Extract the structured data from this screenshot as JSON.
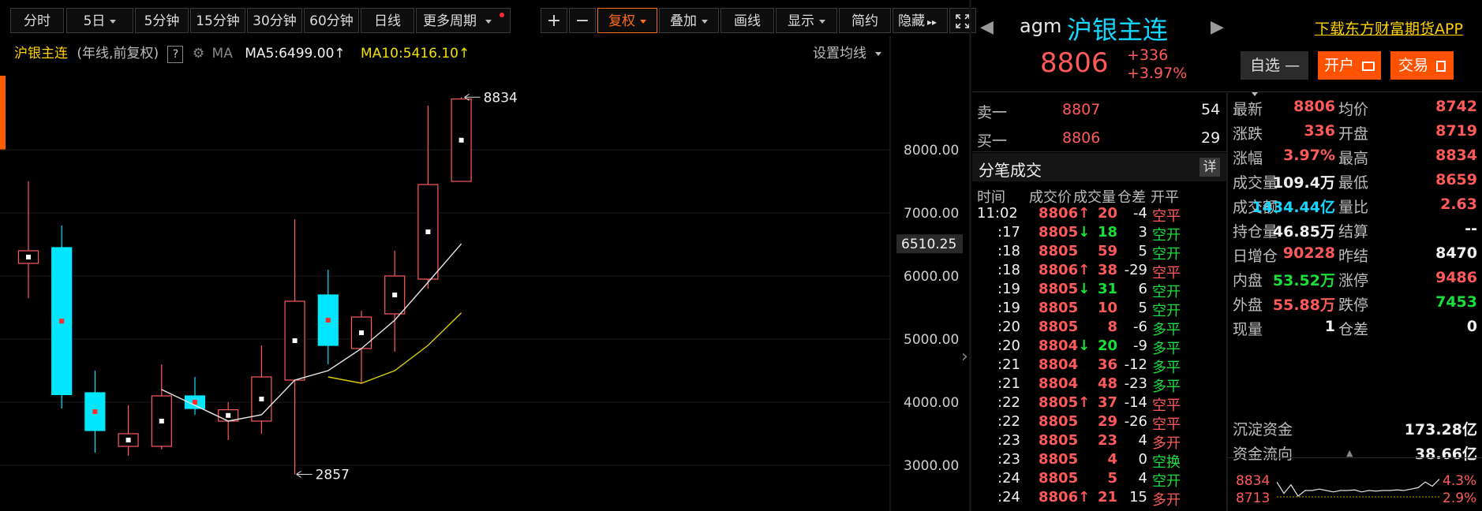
{
  "colors": {
    "up": "#ff5a5a",
    "down": "#00e6ff",
    "ma5": "#e6e6e6",
    "ma10": "#e0d800",
    "accent": "#ff6a1a",
    "buy_green": "#18e03a",
    "cyan": "#16d7ff"
  },
  "toolbar": {
    "tabs": [
      "分时",
      "5日",
      "5分钟",
      "15分钟",
      "30分钟",
      "60分钟",
      "日线",
      "更多周期"
    ],
    "plus": "+",
    "minus": "−",
    "fuquan": "复权",
    "overlay": "叠加",
    "draw": "画线",
    "display": "显示",
    "simple": "简约",
    "hide": "隐藏"
  },
  "legend": {
    "name": "沪银主连",
    "mode": "(年线,前复权)",
    "help": "?",
    "ma": "MA",
    "ma5": "MA5:6499.00",
    "ma10": "MA10:5416.10",
    "settings": "设置均线"
  },
  "chart_data": {
    "type": "candlestick",
    "ylim": [
      2700,
      9300
    ],
    "yticks": [
      3000,
      4000,
      5000,
      6000,
      7000,
      8000
    ],
    "price_tag": "6510.25",
    "price_tag_value": 6510.25,
    "high_annotation": "8834",
    "low_annotation": "2857",
    "candles": [
      {
        "o": 6200,
        "c": 6400,
        "h": 7500,
        "l": 5650
      },
      {
        "o": 6450,
        "c": 4120,
        "h": 6800,
        "l": 3900
      },
      {
        "o": 4150,
        "c": 3550,
        "h": 4500,
        "l": 3200
      },
      {
        "o": 3300,
        "c": 3500,
        "h": 3950,
        "l": 3150
      },
      {
        "o": 3300,
        "c": 4100,
        "h": 4600,
        "l": 3250
      },
      {
        "o": 4100,
        "c": 3900,
        "h": 4400,
        "l": 3800
      },
      {
        "o": 3700,
        "c": 3880,
        "h": 4000,
        "l": 3400
      },
      {
        "o": 3700,
        "c": 4400,
        "h": 4900,
        "l": 3500
      },
      {
        "o": 4350,
        "c": 5600,
        "h": 6900,
        "l": 2857
      },
      {
        "o": 5700,
        "c": 4900,
        "h": 6100,
        "l": 4600
      },
      {
        "o": 4850,
        "c": 5350,
        "h": 5450,
        "l": 4300
      },
      {
        "o": 5400,
        "c": 6000,
        "h": 6400,
        "l": 4800
      },
      {
        "o": 5950,
        "c": 7450,
        "h": 8700,
        "l": 5800
      },
      {
        "o": 7500,
        "c": 8806,
        "h": 8834,
        "l": 7500
      }
    ],
    "ma5": [
      null,
      null,
      null,
      null,
      4200,
      3950,
      3700,
      3800,
      4350,
      4500,
      4850,
      5300,
      5900,
      6510
    ],
    "ma10": [
      null,
      null,
      null,
      null,
      null,
      null,
      null,
      null,
      null,
      4400,
      4300,
      4500,
      4900,
      5416
    ]
  },
  "header": {
    "code": "agm",
    "name": "沪银主连",
    "download": "下载东方财富期货APP",
    "price": "8806",
    "change": "+336",
    "pct": "+3.97%",
    "zixuan": "自选",
    "zixuan_icon": "—",
    "open_btn": "开户",
    "trade_btn": "交易"
  },
  "orderbook": [
    {
      "label": "卖一",
      "price": "8807",
      "vol": "54"
    },
    {
      "label": "买一",
      "price": "8806",
      "vol": "29"
    }
  ],
  "ticks_header": {
    "title": "分笔成交",
    "detail": "详",
    "cols": [
      "时间",
      "成交价",
      "成交量",
      "仓差",
      "开平"
    ]
  },
  "ticks": [
    {
      "t": "11:02",
      "p": "8806",
      "a": "up",
      "v": "20",
      "d": "-4",
      "k": "空平",
      "kc": "red"
    },
    {
      "t": ":17",
      "p": "8805",
      "a": "down",
      "v": "18",
      "d": "3",
      "k": "空开",
      "kc": "green"
    },
    {
      "t": ":18",
      "p": "8805",
      "a": "",
      "v": "59",
      "d": "5",
      "k": "空开",
      "kc": "green"
    },
    {
      "t": ":18",
      "p": "8806",
      "a": "up",
      "v": "38",
      "d": "-29",
      "k": "空平",
      "kc": "red"
    },
    {
      "t": ":19",
      "p": "8805",
      "a": "down",
      "v": "31",
      "d": "6",
      "k": "空开",
      "kc": "green"
    },
    {
      "t": ":19",
      "p": "8805",
      "a": "",
      "v": "10",
      "d": "5",
      "k": "空开",
      "kc": "green"
    },
    {
      "t": ":20",
      "p": "8805",
      "a": "",
      "v": "8",
      "d": "-6",
      "k": "多平",
      "kc": "green"
    },
    {
      "t": ":20",
      "p": "8804",
      "a": "down",
      "v": "20",
      "d": "-9",
      "k": "多平",
      "kc": "green"
    },
    {
      "t": ":21",
      "p": "8804",
      "a": "",
      "v": "36",
      "d": "-12",
      "k": "多平",
      "kc": "green"
    },
    {
      "t": ":21",
      "p": "8804",
      "a": "",
      "v": "48",
      "d": "-23",
      "k": "多平",
      "kc": "green"
    },
    {
      "t": ":22",
      "p": "8805",
      "a": "up",
      "v": "37",
      "d": "-14",
      "k": "空平",
      "kc": "red"
    },
    {
      "t": ":22",
      "p": "8805",
      "a": "",
      "v": "29",
      "d": "-26",
      "k": "空平",
      "kc": "red"
    },
    {
      "t": ":23",
      "p": "8805",
      "a": "",
      "v": "23",
      "d": "4",
      "k": "多开",
      "kc": "red"
    },
    {
      "t": ":23",
      "p": "8805",
      "a": "",
      "v": "4",
      "d": "0",
      "k": "空换",
      "kc": "green"
    },
    {
      "t": ":24",
      "p": "8805",
      "a": "",
      "v": "5",
      "d": "4",
      "k": "空开",
      "kc": "green"
    },
    {
      "t": ":24",
      "p": "8806",
      "a": "up",
      "v": "21",
      "d": "15",
      "k": "多开",
      "kc": "red"
    }
  ],
  "stats": [
    [
      {
        "l": "最新",
        "v": "8806",
        "c": "red"
      },
      {
        "l": "均价",
        "v": "8742",
        "c": "red"
      }
    ],
    [
      {
        "l": "涨跌",
        "v": "336",
        "c": "red"
      },
      {
        "l": "开盘",
        "v": "8719",
        "c": "red"
      }
    ],
    [
      {
        "l": "涨幅",
        "v": "3.97%",
        "c": "red"
      },
      {
        "l": "最高",
        "v": "8834",
        "c": "red"
      }
    ],
    [
      {
        "l": "成交量",
        "v": "109.4万",
        "c": "white"
      },
      {
        "l": "最低",
        "v": "8659",
        "c": "red"
      }
    ],
    [
      {
        "l": "成交额",
        "v": "1434.44亿",
        "c": "cyan"
      },
      {
        "l": "量比",
        "v": "2.63",
        "c": "red"
      }
    ],
    [
      {
        "l": "持仓量",
        "v": "46.85万",
        "c": "white"
      },
      {
        "l": "结算",
        "v": "--",
        "c": "white"
      }
    ],
    [
      {
        "l": "日增仓",
        "v": "90228",
        "c": "red"
      },
      {
        "l": "昨结",
        "v": "8470",
        "c": "white"
      }
    ],
    [
      {
        "l": "内盘",
        "v": "53.52万",
        "c": "green"
      },
      {
        "l": "涨停",
        "v": "9486",
        "c": "red"
      }
    ],
    [
      {
        "l": "外盘",
        "v": "55.88万",
        "c": "red"
      },
      {
        "l": "跌停",
        "v": "7453",
        "c": "green"
      }
    ],
    [
      {
        "l": "现量",
        "v": "1",
        "c": "white"
      },
      {
        "l": "仓差",
        "v": "0",
        "c": "white"
      }
    ]
  ],
  "funds": [
    {
      "l": "沉淀资金",
      "v": "173.28亿"
    },
    {
      "l": "资金流向",
      "v": "38.66亿"
    }
  ],
  "mini": {
    "p_high": "8834",
    "p_mid": "8713",
    "pct_high": "4.3%",
    "pct_mid": "2.9%",
    "line": [
      0.2,
      0.6,
      0.3,
      0.7,
      0.5,
      0.5,
      0.45,
      0.5,
      0.55,
      0.5,
      0.5,
      0.48,
      0.55,
      0.5,
      0.52,
      0.5,
      0.5,
      0.48,
      0.5,
      0.45,
      0.4,
      0.2,
      0.35,
      0.1
    ]
  }
}
